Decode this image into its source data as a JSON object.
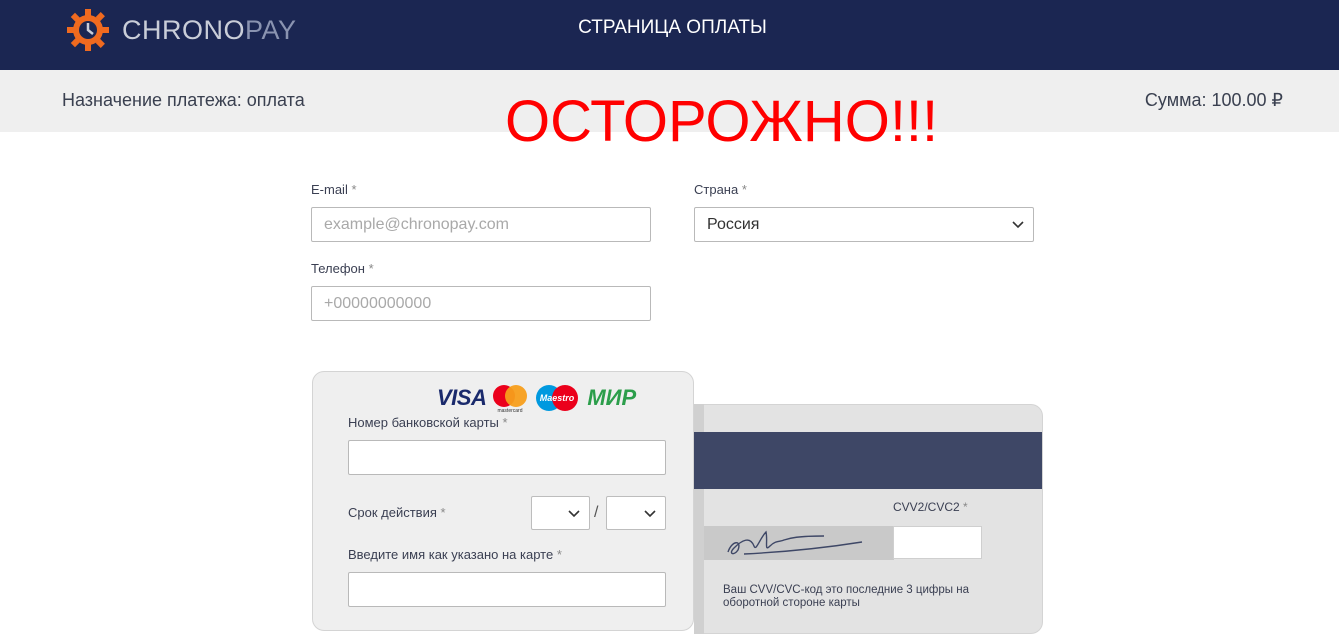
{
  "header": {
    "logo_chrono": "CHRONO",
    "logo_pay": "PAY",
    "title": "СТРАНИЦА ОПЛАТЫ"
  },
  "info": {
    "purpose": "Назначение платежа: оплата",
    "amount": "Сумма: 100.00 ₽"
  },
  "overlay": {
    "warning": "ОСТОРОЖНО!!!"
  },
  "form": {
    "email_label": "E-mail",
    "email_placeholder": "example@chronopay.com",
    "country_label": "Страна",
    "country_value": "Россия",
    "phone_label": "Телефон",
    "phone_placeholder": "+00000000000",
    "required_mark": "*"
  },
  "card": {
    "brands": [
      "VISA",
      "mastercard",
      "Maestro",
      "МИР"
    ],
    "number_label": "Номер банковской карты",
    "expiry_label": "Срок действия",
    "expiry_separator": "/",
    "name_label": "Введите имя как указано на карте",
    "cvv_label": "CVV2/CVC2",
    "cvv_hint": "Ваш CVV/CVC-код это последние 3 цифры на оборотной стороне карты"
  },
  "colors": {
    "header_bg": "#1b2652",
    "info_bg": "#efefef",
    "warning": "#ff0000",
    "logo_gear": "#f06a1f"
  }
}
